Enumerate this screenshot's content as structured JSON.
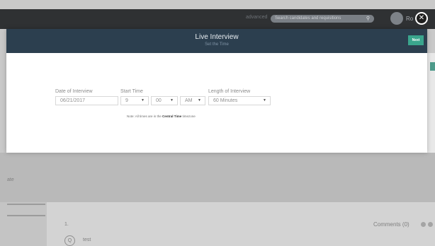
{
  "background": {
    "advanced_label": "advanced",
    "search_placeholder": "Search candidates and requisitions",
    "user_name": "Ro",
    "mid_text": "ate",
    "list_number": "1.",
    "list_icon": "Q",
    "list_text": "test",
    "comments_label": "Comments (0)"
  },
  "modal": {
    "title": "Live Interview",
    "subtitle": "Set the Time",
    "next_label": "Next",
    "close_label": "✕"
  },
  "form": {
    "date_label": "Date of Interview",
    "date_value": "06/21/2017",
    "start_time_label": "Start Time",
    "hour_value": "9",
    "minute_value": "00",
    "ampm_value": "AM",
    "length_label": "Length of Interview",
    "length_value": "60 Minutes",
    "note_prefix": "Note: All times are in the ",
    "note_zone": "Central Time",
    "note_suffix": " timezone"
  },
  "icons": {
    "search": "search-icon",
    "close": "close-icon",
    "caret": "chevron-down-icon"
  },
  "colors": {
    "header_bg": "#2c3f4f",
    "accent_green": "#3aa58d",
    "topbar_bg": "#2f3133"
  }
}
